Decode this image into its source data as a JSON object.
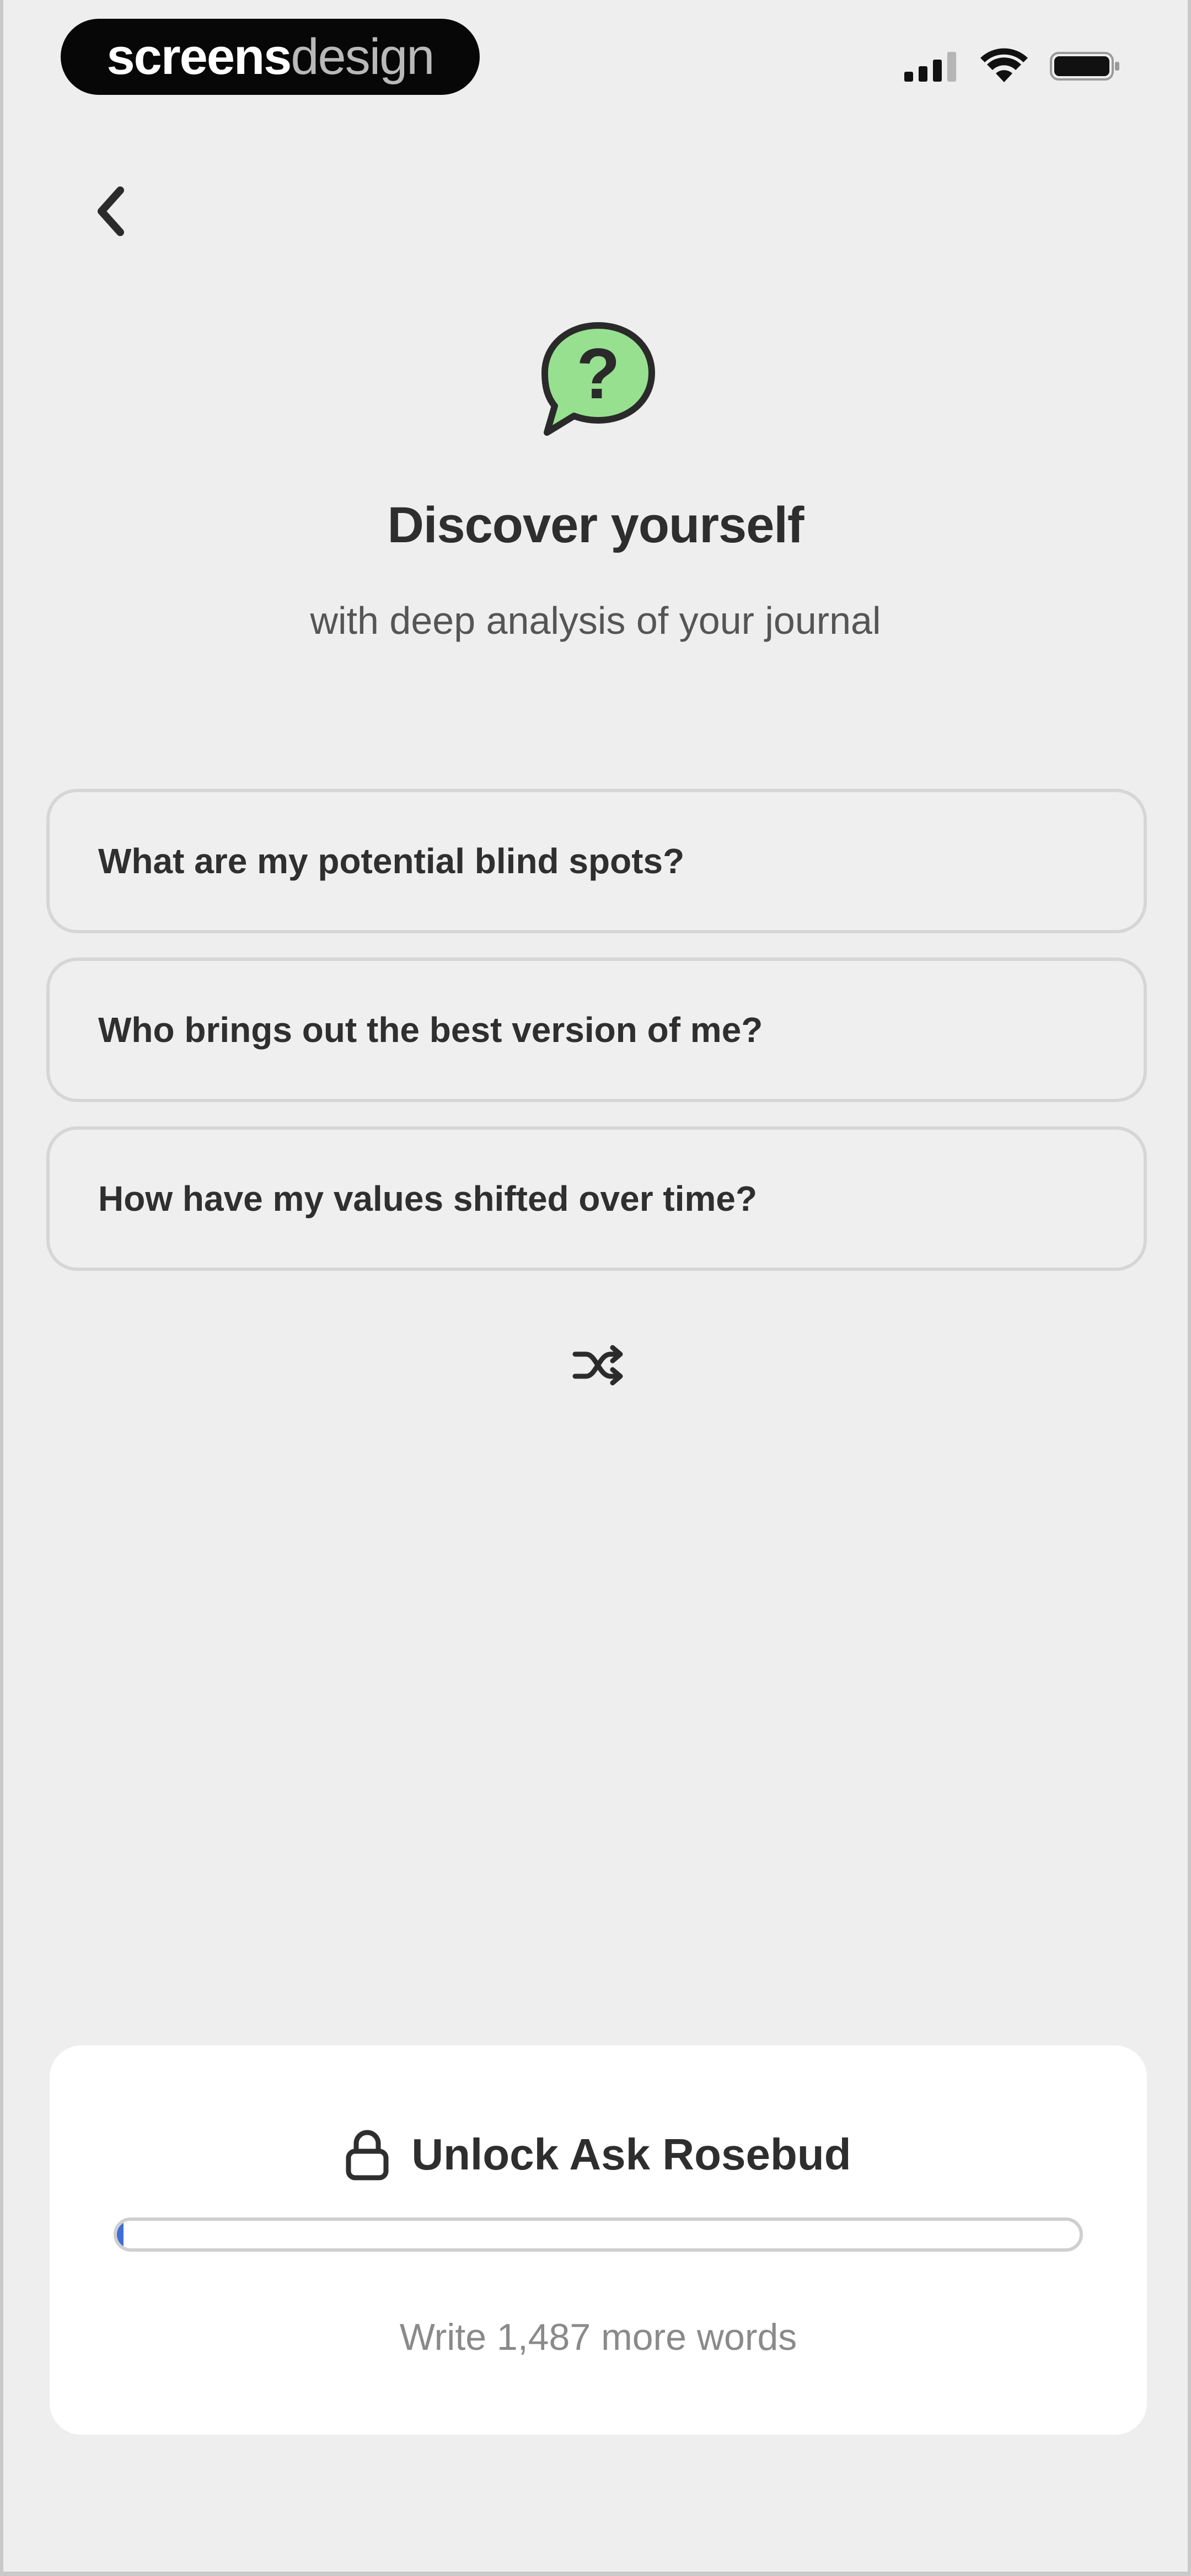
{
  "status_bar": {
    "brand_bold": "screens",
    "brand_light": "design",
    "icons": [
      "signal-icon",
      "wifi-icon",
      "battery-icon"
    ]
  },
  "nav": {
    "back_icon": "chevron-left-icon"
  },
  "hero": {
    "icon": "question-speech-bubble-icon",
    "title": "Discover yourself",
    "subtitle": "with deep analysis of your journal"
  },
  "prompts": [
    {
      "text": "What are my potential blind spots?"
    },
    {
      "text": "Who brings out the best version of me?"
    },
    {
      "text": "How have my values shifted over time?"
    }
  ],
  "shuffle": {
    "icon": "shuffle-icon"
  },
  "unlock": {
    "icon": "lock-icon",
    "label": "Unlock Ask Rosebud",
    "progress_fraction": 0.005,
    "words_remaining_text": "Write 1,487 more words"
  },
  "colors": {
    "background": "#eeeeee",
    "panel": "#ffffff",
    "accent_green": "#97e090",
    "progress_blue": "#3f6fd6",
    "text_primary": "#2e2e2e",
    "text_secondary": "#8a8a8a"
  }
}
